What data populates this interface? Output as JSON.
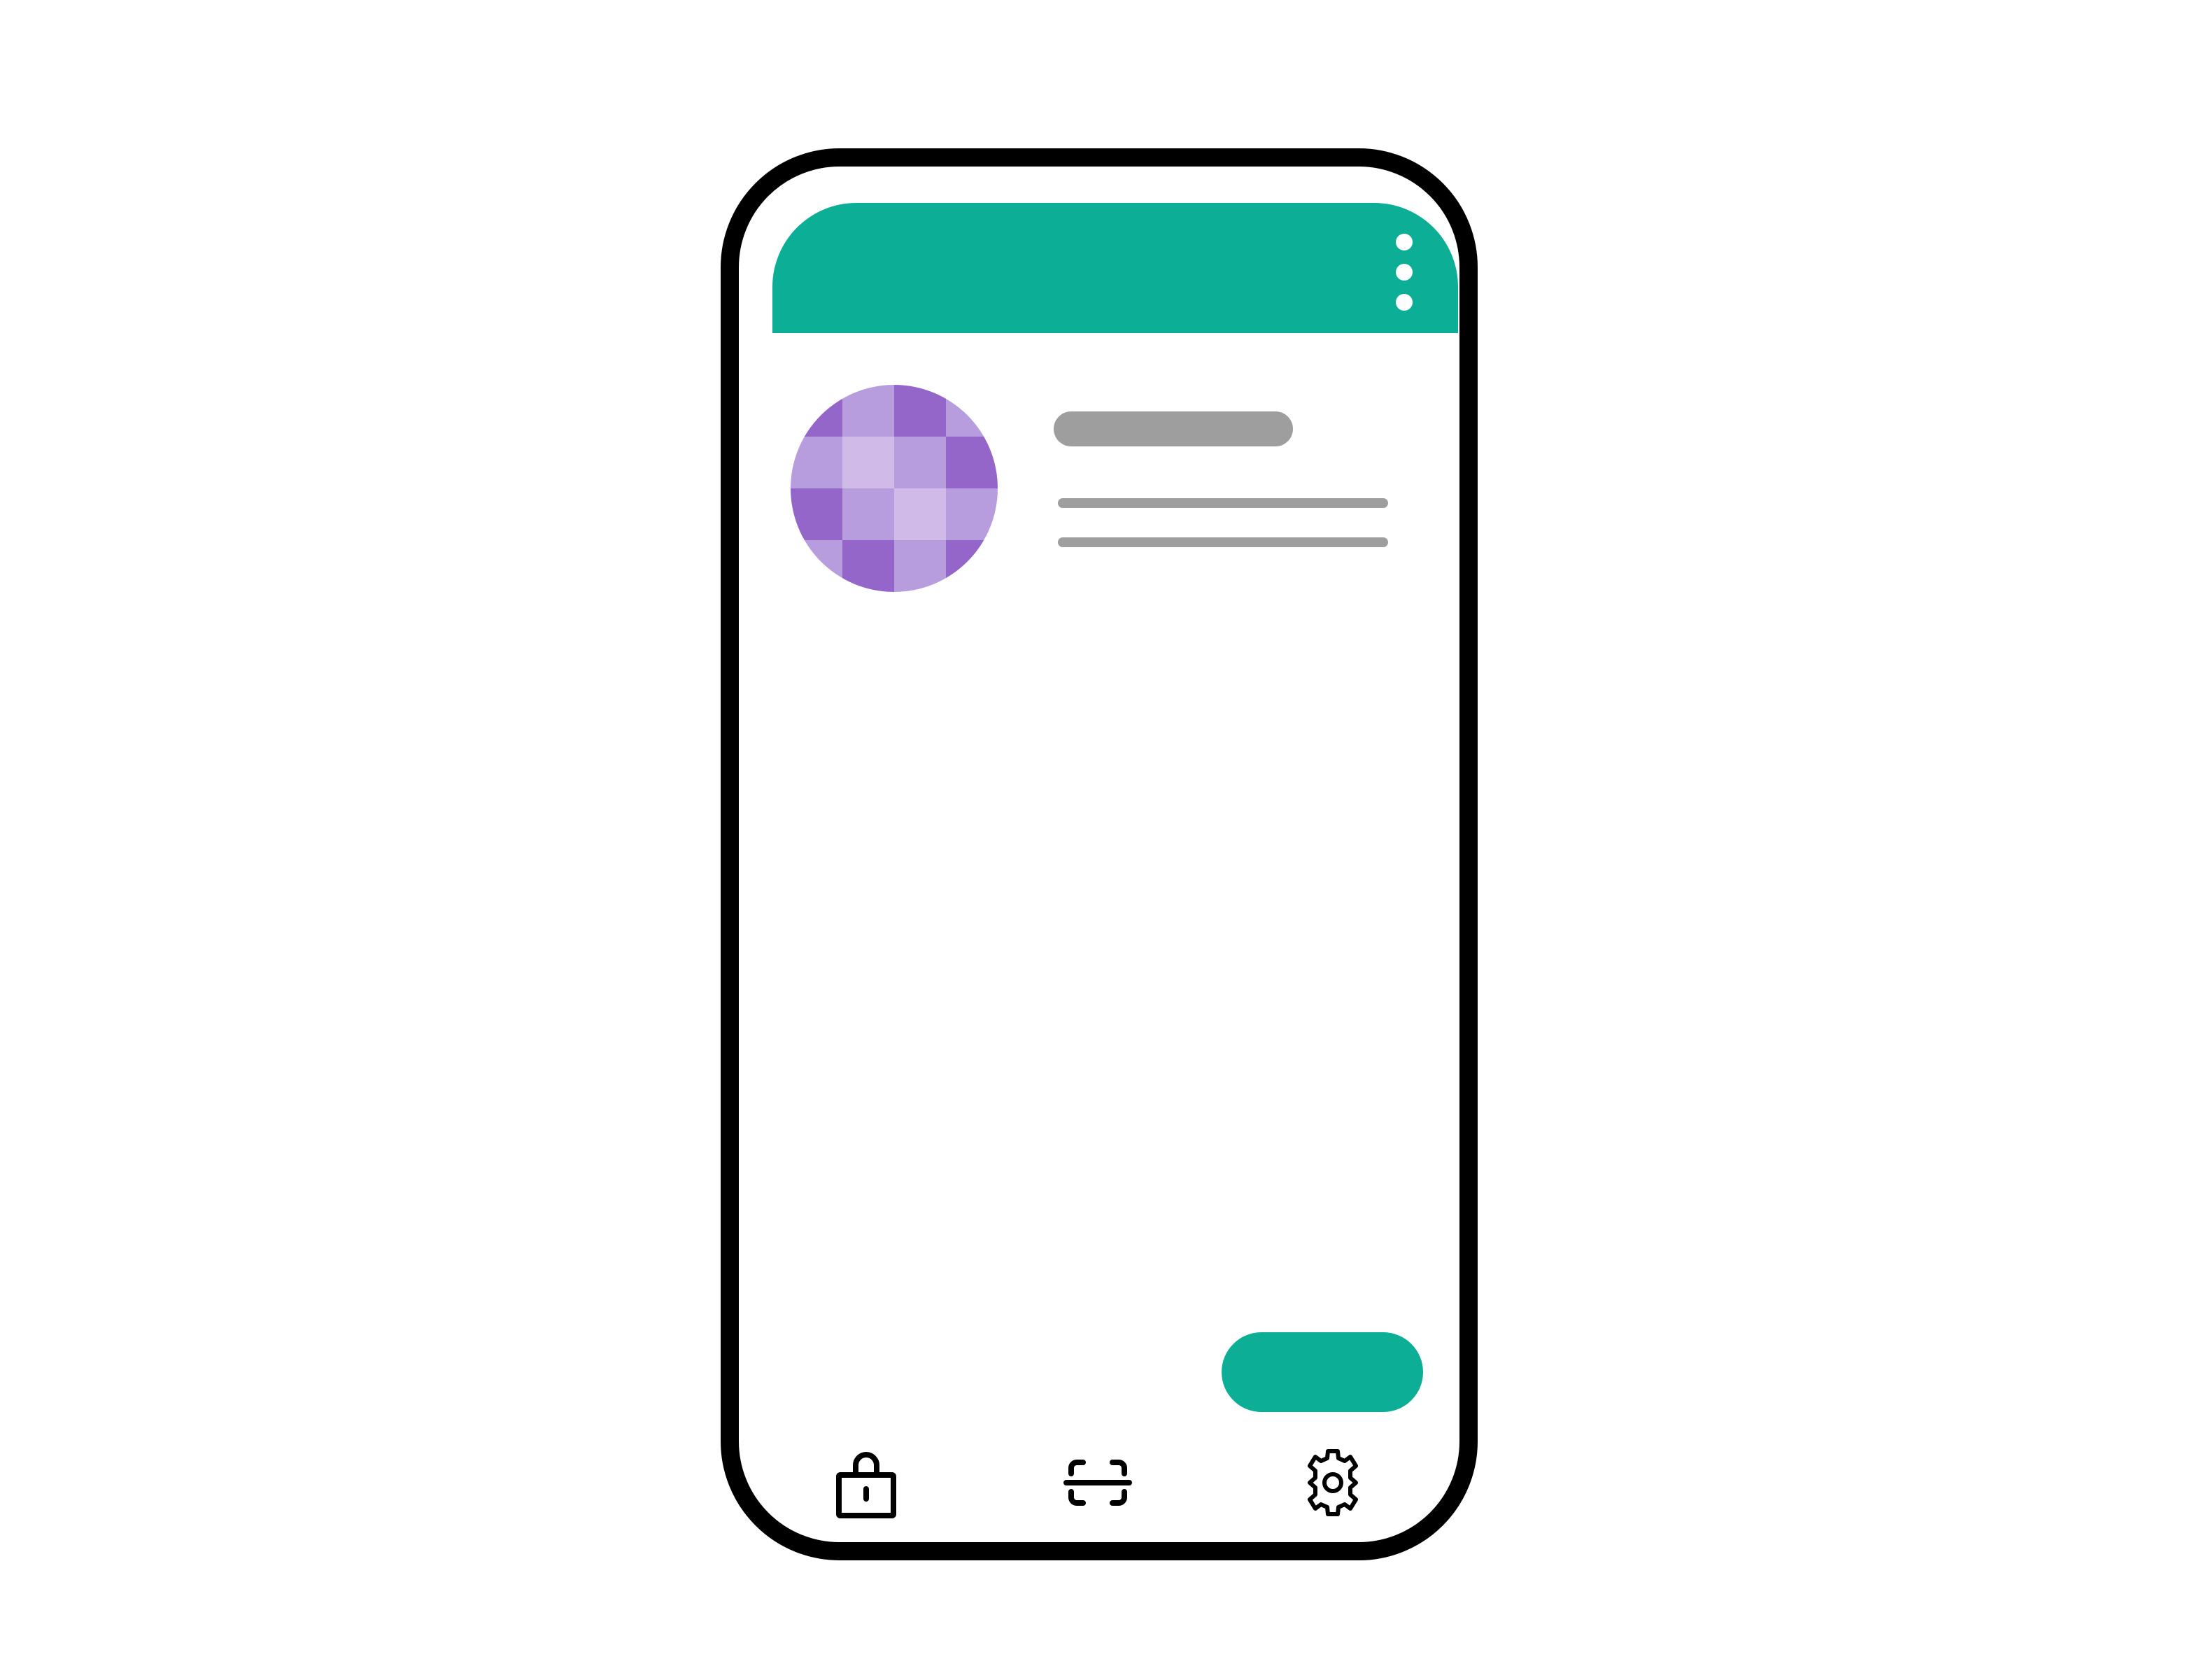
{
  "app": {
    "header": {
      "accent_color": "#0cae96",
      "menu_icon": "more-vertical-icon"
    },
    "profile": {
      "avatar_icon": "pixel-globe-avatar",
      "avatar_colors": [
        "#9466c9",
        "#b79ddd",
        "#cfbae8"
      ],
      "title_placeholder_color": "#9e9e9e"
    },
    "fab": {
      "color": "#0cae96"
    },
    "bottom_nav": {
      "items": [
        {
          "icon": "lock-icon"
        },
        {
          "icon": "scan-icon"
        },
        {
          "icon": "gear-icon"
        }
      ]
    }
  }
}
